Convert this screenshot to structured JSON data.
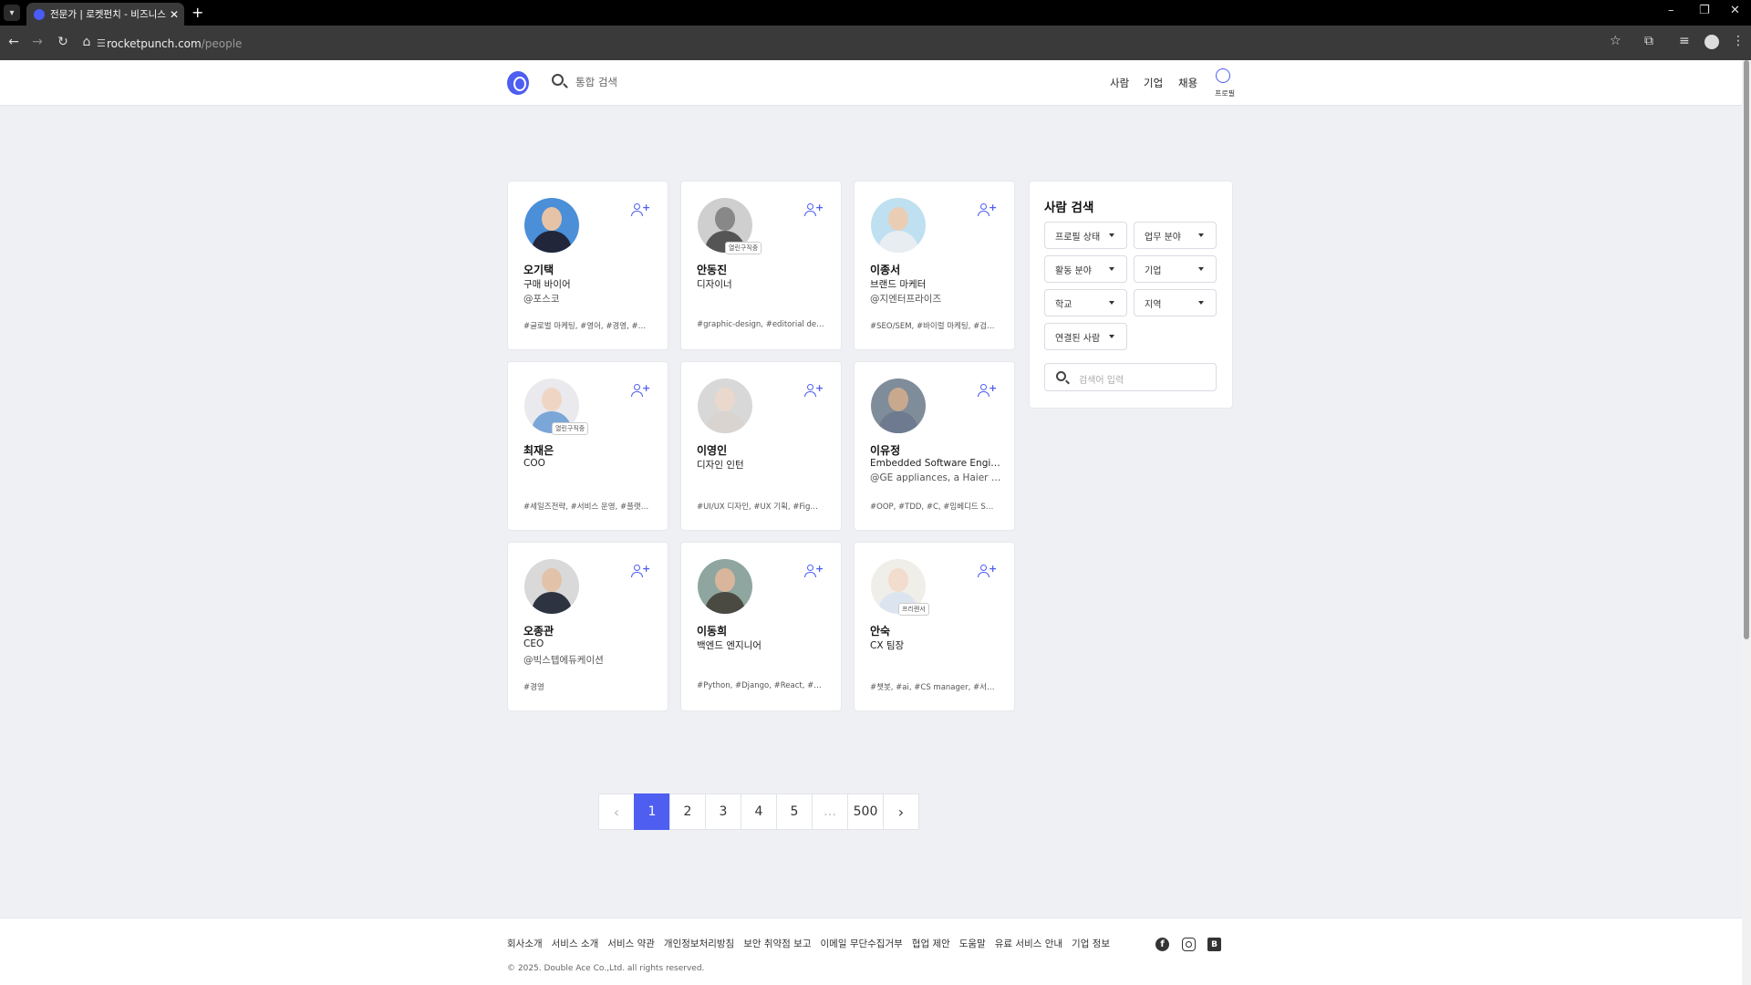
{
  "browser": {
    "tab_title": "전문가 | 로켓펀치 - 비즈니스 네",
    "url_host": "rocketpunch.com",
    "url_path": "/people"
  },
  "header": {
    "search_placeholder": "통합 검색",
    "nav": [
      "사람",
      "기업",
      "채용"
    ],
    "profile_label": "프로필"
  },
  "people": [
    {
      "name": "오기택",
      "role": "구매 바이어",
      "company": "@포스코",
      "tags": "#글로벌 마케팅, #영어, #경영, #인…",
      "badge": "",
      "skin": "#e6c3a6",
      "cloth": "#22263a",
      "bg": "#4a8fd8"
    },
    {
      "name": "안동진",
      "role": "디자이너",
      "company": "",
      "tags": "#graphic-design, #editorial des…",
      "badge": "열린구직중",
      "skin": "#888888",
      "cloth": "#555555",
      "bg": "#cfcfcf"
    },
    {
      "name": "이종서",
      "role": "브랜드 마케터",
      "company": "@지엔터프라이즈",
      "tags": "#SEO/SEM, #바이럴 마케팅, #검…",
      "badge": "",
      "skin": "#eacdb5",
      "cloth": "#e8edf2",
      "bg": "#bfe0f0"
    },
    {
      "name": "최재은",
      "role": "COO",
      "company": "",
      "tags": "#세일즈전략, #서비스 운영, #플랫…",
      "badge": "열린구직중",
      "skin": "#efd6c4",
      "cloth": "#7aa6d8",
      "bg": "#e9e9ee"
    },
    {
      "name": "이영인",
      "role": "디자인 인턴",
      "company": "",
      "tags": "#UI/UX 디자인, #UX 기획, #Figm…",
      "badge": "",
      "skin": "#ead8cc",
      "cloth": "#d9d4cf",
      "bg": "#d8d8d8"
    },
    {
      "name": "이유정",
      "role": "Embedded Software Engi…",
      "company": "@GE appliances, a Haier c…",
      "tags": "#OOP, #TDD, #C, #임베디드 SW …",
      "badge": "",
      "skin": "#c9a98e",
      "cloth": "#6d7a90",
      "bg": "#7f8c99"
    },
    {
      "name": "오종관",
      "role": "CEO",
      "company": "@빅스텝에듀케이션",
      "tags": "#경영",
      "badge": "",
      "skin": "#e2c2a8",
      "cloth": "#2d3340",
      "bg": "#d9d9d9"
    },
    {
      "name": "이동희",
      "role": "백엔드 엔지니어",
      "company": "",
      "tags": "#Python, #Django, #React, #Git…",
      "badge": "",
      "skin": "#d9b69b",
      "cloth": "#4a4a42",
      "bg": "#8fa6a0"
    },
    {
      "name": "안숙",
      "role": "CX 팀장",
      "company": "",
      "tags": "#챗봇, #ai, #CS manager, #서비…",
      "badge": "프리랜서",
      "skin": "#f1dccd",
      "cloth": "#dbe4ef",
      "bg": "#f0eee9"
    }
  ],
  "sidebar": {
    "title": "사람 검색",
    "filters": [
      "프로필 상태",
      "업무 분야",
      "활동 분야",
      "기업",
      "학교",
      "지역",
      "연결된 사람"
    ],
    "search_placeholder": "검색어 입력"
  },
  "pagination": {
    "prev": "‹",
    "pages": [
      "1",
      "2",
      "3",
      "4",
      "5",
      "…",
      "500"
    ],
    "active": "1",
    "next": "›"
  },
  "footer": {
    "links": [
      "회사소개",
      "서비스 소개",
      "서비스 약관",
      "개인정보처리방침",
      "보안 취약점 보고",
      "이메일 무단수집거부",
      "협업 제안",
      "도움말",
      "유료 서비스 안내",
      "기업 정보"
    ],
    "copyright": "© 2025. Double Ace Co.,Ltd. all rights reserved."
  }
}
